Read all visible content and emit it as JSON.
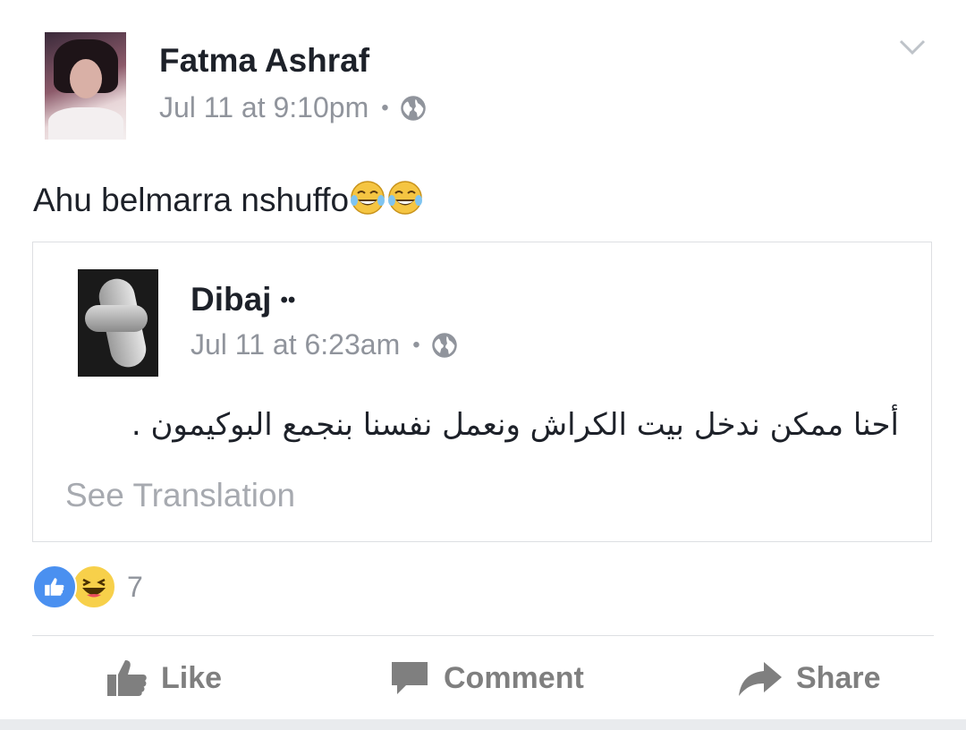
{
  "post": {
    "author": "Fatma Ashraf",
    "timestamp": "Jul 11 at 9:10pm",
    "separator": "•",
    "privacy_icon": "globe-icon",
    "text": "Ahu belmarra nshuffo",
    "emojis": [
      "face-with-tears-of-joy",
      "face-with-tears-of-joy"
    ]
  },
  "shared_post": {
    "author": "Dibaj",
    "author_suffix": "••",
    "timestamp": "Jul 11 at 6:23am",
    "separator": "•",
    "privacy_icon": "globe-icon",
    "text": "أحنا ممكن ندخل بيت الكراش ونعمل نفسنا بنجمع البوكيمون .",
    "see_translation": "See Translation"
  },
  "reactions": {
    "types": [
      "like",
      "haha"
    ],
    "count": "7"
  },
  "actions": {
    "like_label": "Like",
    "comment_label": "Comment",
    "share_label": "Share"
  },
  "colors": {
    "text": "#1d2129",
    "meta": "#90949c",
    "action": "#7f7f7f",
    "like_blue": "#4a90f0",
    "haha_yellow": "#f7d04a",
    "border": "#dddfe2"
  }
}
